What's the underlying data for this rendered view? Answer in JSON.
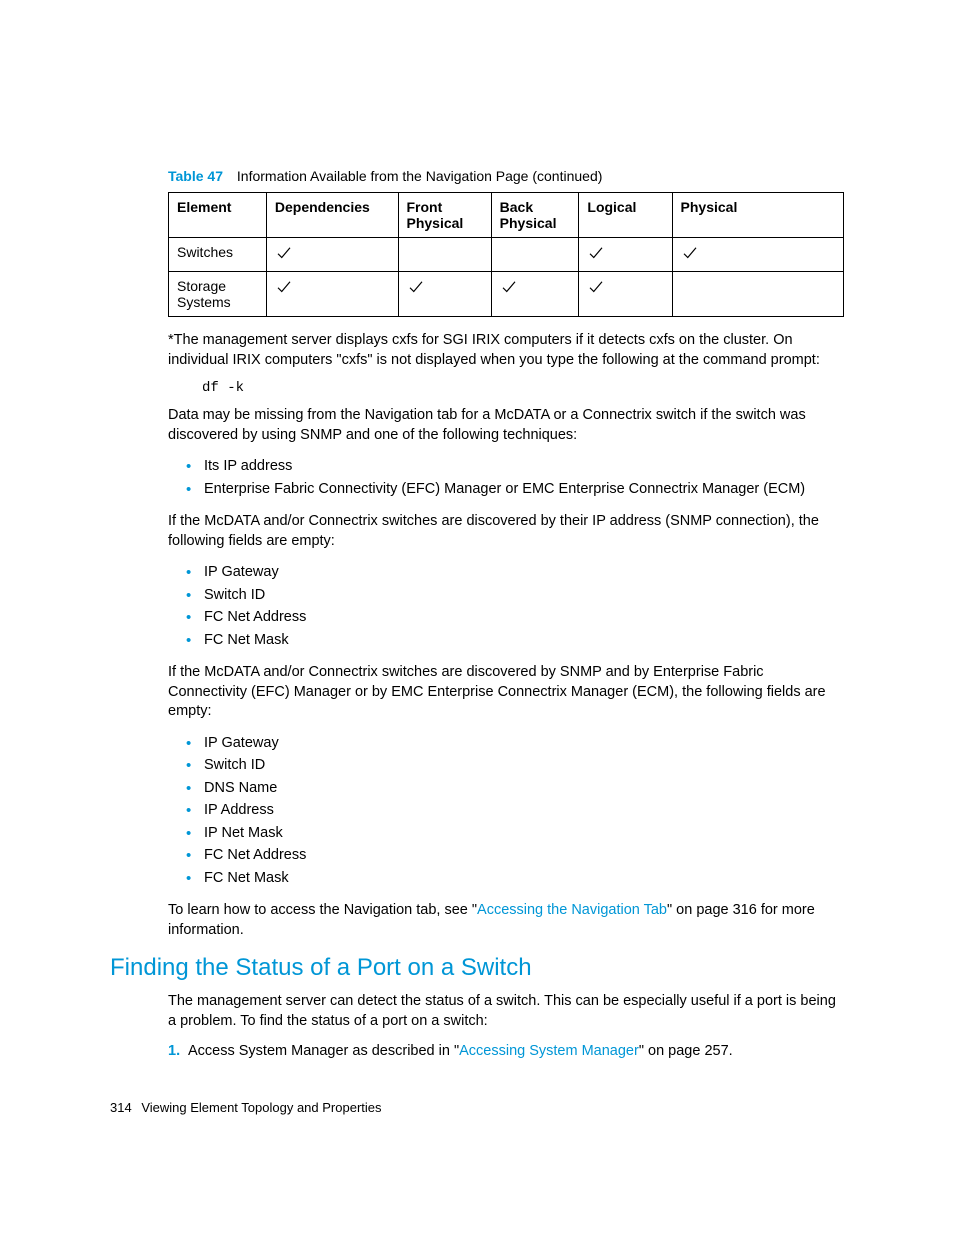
{
  "caption": {
    "num": "Table 47",
    "title": "Information Available from the Navigation Page (continued)"
  },
  "table": {
    "headers": [
      "Element",
      "Dependencies",
      "Front Physical",
      "Back Physical",
      "Logical",
      "Physical"
    ],
    "rows": [
      {
        "label": "Switches",
        "checks": [
          true,
          false,
          false,
          true,
          true
        ]
      },
      {
        "label": "Storage Systems",
        "checks": [
          true,
          true,
          true,
          true,
          false
        ]
      }
    ]
  },
  "para_note": "*The management server displays cxfs for SGI IRIX computers if it detects cxfs on the cluster. On individual IRIX computers \"cxfs\" is not displayed when you type the following at the command prompt:",
  "cmd": "df -k",
  "para_data_missing": "Data may be missing from the Navigation tab for a McDATA or a Connectrix switch if the switch was discovered by using SNMP and one of the following techniques:",
  "list_techniques": [
    "Its IP address",
    "Enterprise Fabric Connectivity (EFC) Manager or EMC Enterprise Connectrix Manager (ECM)"
  ],
  "para_ip_snmp": "If the McDATA and/or Connectrix switches are discovered by their IP address (SNMP connection), the following fields are empty:",
  "list_ip_fields": [
    "IP Gateway",
    "Switch ID",
    "FC Net Address",
    "FC Net Mask"
  ],
  "para_snmp_efc": "If the McDATA and/or Connectrix switches are discovered by SNMP and by Enterprise Fabric Connectivity (EFC) Manager or by EMC Enterprise Connectrix Manager (ECM), the following fields are empty:",
  "list_efc_fields": [
    "IP Gateway",
    "Switch ID",
    "DNS Name",
    "IP Address",
    "IP Net Mask",
    "FC Net Address",
    "FC Net Mask"
  ],
  "para_learn_pre": "To learn how to access the Navigation tab, see \"",
  "para_learn_link": "Accessing the Navigation Tab",
  "para_learn_post": "\" on page 316 for more information.",
  "section_heading": "Finding the Status of a Port on a Switch",
  "para_section": "The management server can detect the status of a switch. This can be especially useful if a port is being a problem. To find the status of a port on a switch:",
  "step1_num": "1.",
  "step1_pre": "Access System Manager as described in \"",
  "step1_link": "Accessing System Manager",
  "step1_post": "\" on page 257.",
  "footer_page": "314",
  "footer_text": "Viewing Element Topology and Properties"
}
